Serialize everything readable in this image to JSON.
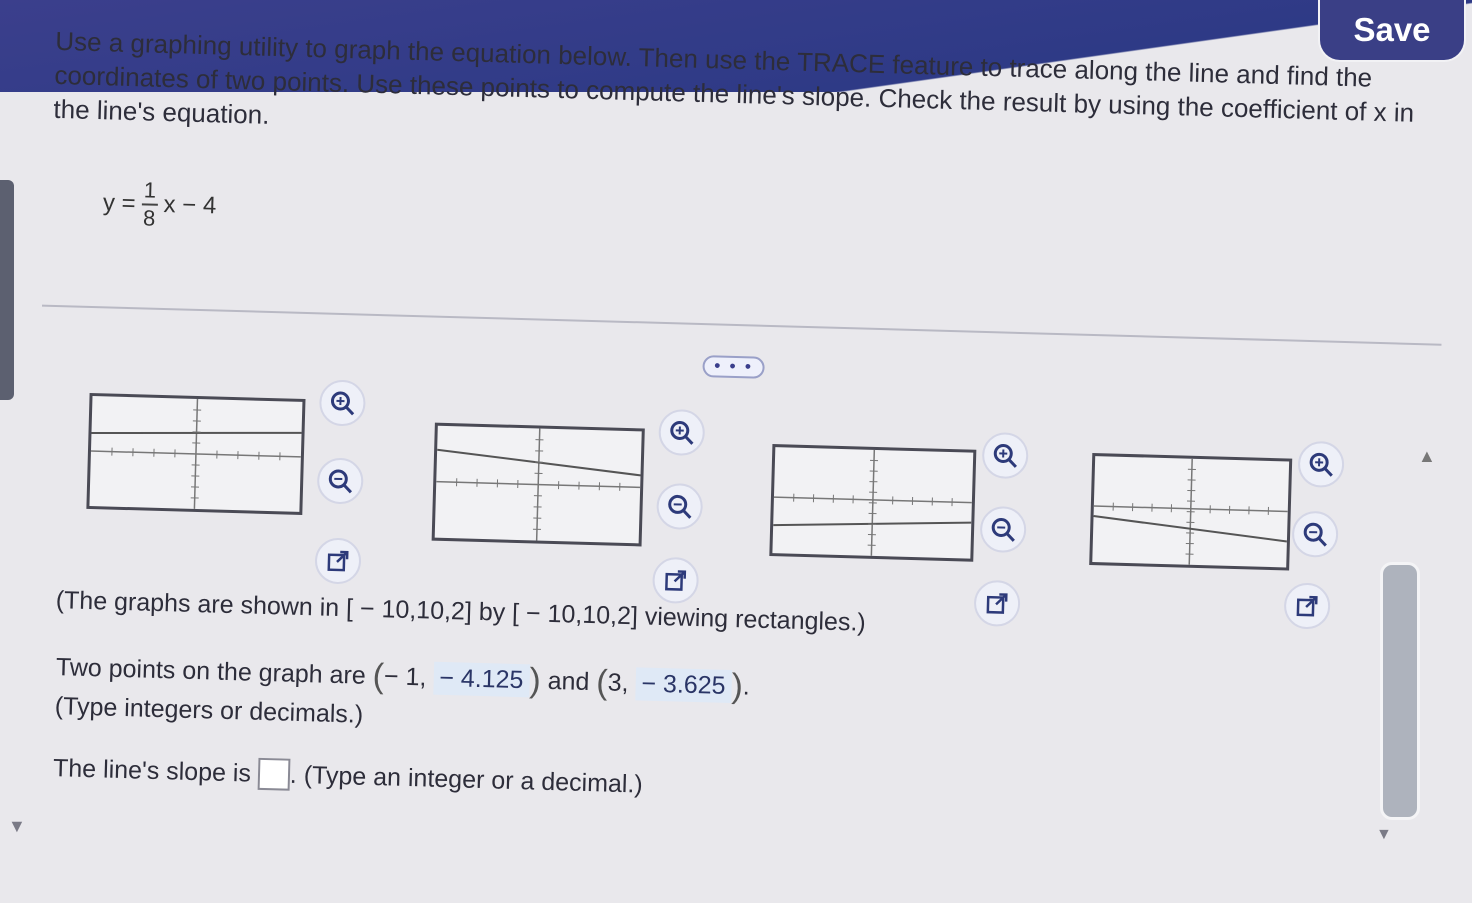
{
  "header": {
    "save_label": "Save"
  },
  "instructions": "Use a graphing utility to graph the equation below. Then use the TRACE feature to trace along the line and find the coordinates of two points. Use these points to compute the line's slope. Check the result by using the coefficient of x in the line's equation.",
  "equation": {
    "lhs": "y =",
    "numerator": "1",
    "denominator": "8",
    "rest": "x − 4"
  },
  "more_button": "• • •",
  "graph_options": [
    {
      "name": "graph-a",
      "line": "slight positive, above axis"
    },
    {
      "name": "graph-b",
      "line": "negative, above axis"
    },
    {
      "name": "graph-c",
      "line": "slight positive, below axis"
    },
    {
      "name": "graph-d",
      "line": "negative, below axis"
    }
  ],
  "viewing_note": "(The graphs are shown in [ − 10,10,2] by [ − 10,10,2] viewing rectangles.)",
  "points": {
    "prefix": "Two points on the graph are",
    "p1_x": "− 1,",
    "p1_y": "− 4.125",
    "and": "and",
    "p2_x": "3,",
    "p2_y": "− 3.625",
    "hint": "(Type integers or decimals.)"
  },
  "slope": {
    "prefix": "The line's slope is",
    "suffix": ". (Type an integer or a decimal.)",
    "value": ""
  },
  "icons": [
    "zoom-in-icon",
    "zoom-out-icon",
    "expand-icon"
  ],
  "colors": {
    "header": "#2e3a86",
    "answer_bg": "#dfe9f6",
    "accent": "#3b3f8c"
  }
}
